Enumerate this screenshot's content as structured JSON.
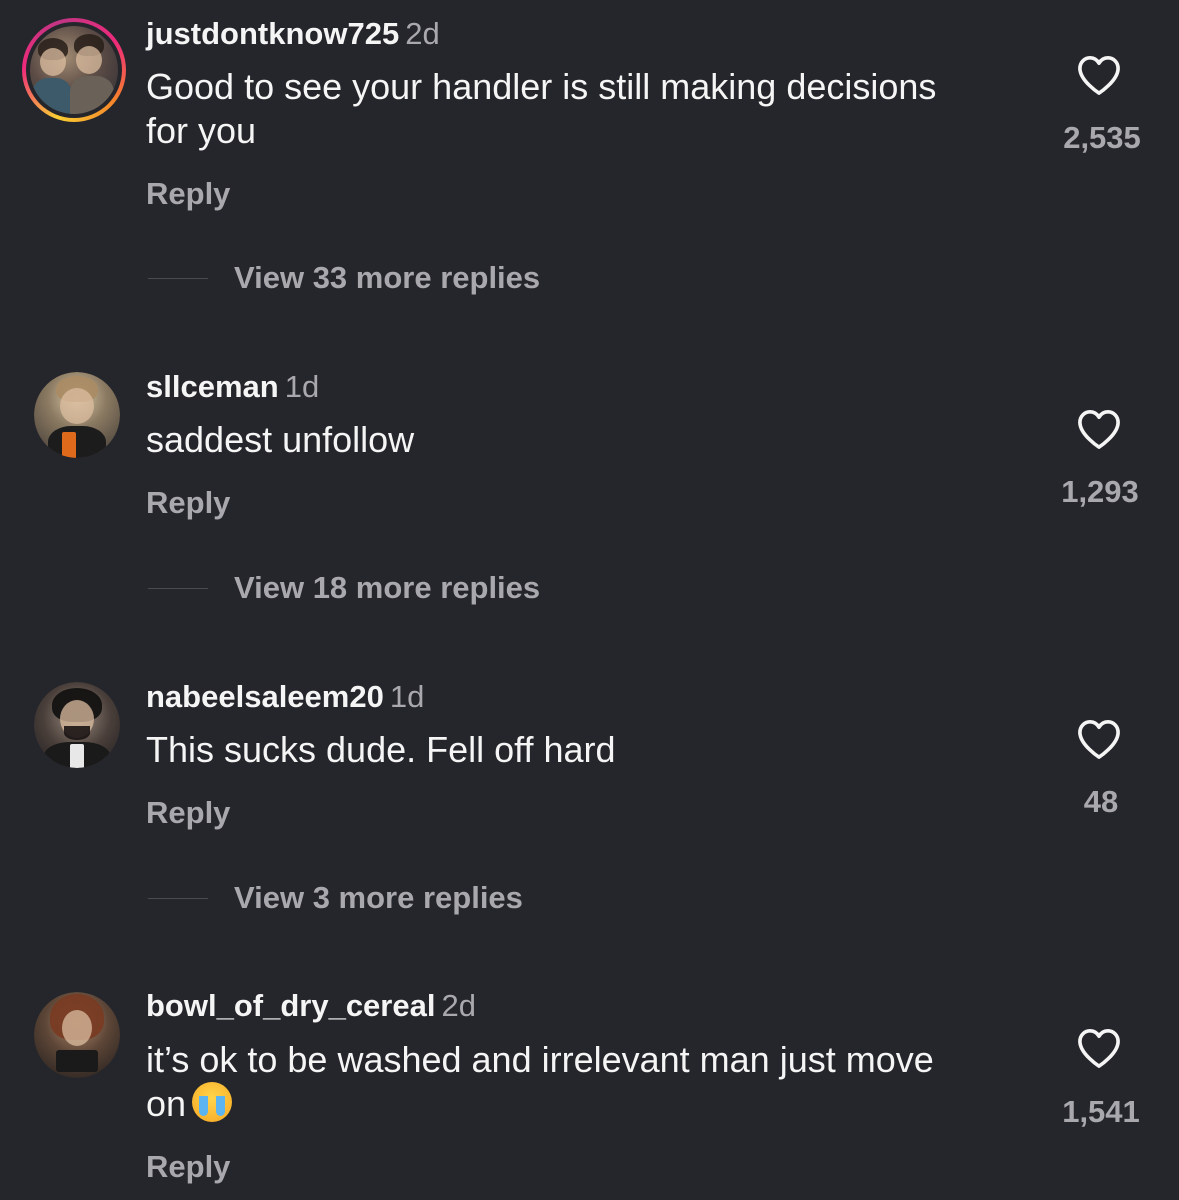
{
  "comments": [
    {
      "username": "justdontknow725",
      "time": "2d",
      "text_line1": "Good to see your handler is still making decisions",
      "text_line2": "for you",
      "reply_label": "Reply",
      "view_more": "View 33 more replies",
      "likes": "2,535",
      "has_story_ring": true
    },
    {
      "username": "sllceman",
      "time": "1d",
      "text_line1": "saddest unfollow",
      "reply_label": "Reply",
      "view_more": "View 18 more replies",
      "likes": "1,293",
      "has_story_ring": false
    },
    {
      "username": "nabeelsaleem20",
      "time": "1d",
      "text_line1": "This sucks dude. Fell off hard",
      "reply_label": "Reply",
      "view_more": "View 3 more replies",
      "likes": "48",
      "has_story_ring": false
    },
    {
      "username": "bowl_of_dry_cereal",
      "time": "2d",
      "text_line1": "it’s ok to be washed and irrelevant man just move",
      "text_line2": "on",
      "emoji": "loudly-crying-face",
      "reply_label": "Reply",
      "likes": "1,541",
      "has_story_ring": false
    }
  ],
  "icons": {
    "like": "heart-outline-icon"
  },
  "colors": {
    "background": "#25262b",
    "primary_text": "#f5f5f5",
    "secondary_text": "#a8a8ad",
    "story_ring": [
      "#f9ce34",
      "#ee2a7b",
      "#c13584"
    ]
  }
}
